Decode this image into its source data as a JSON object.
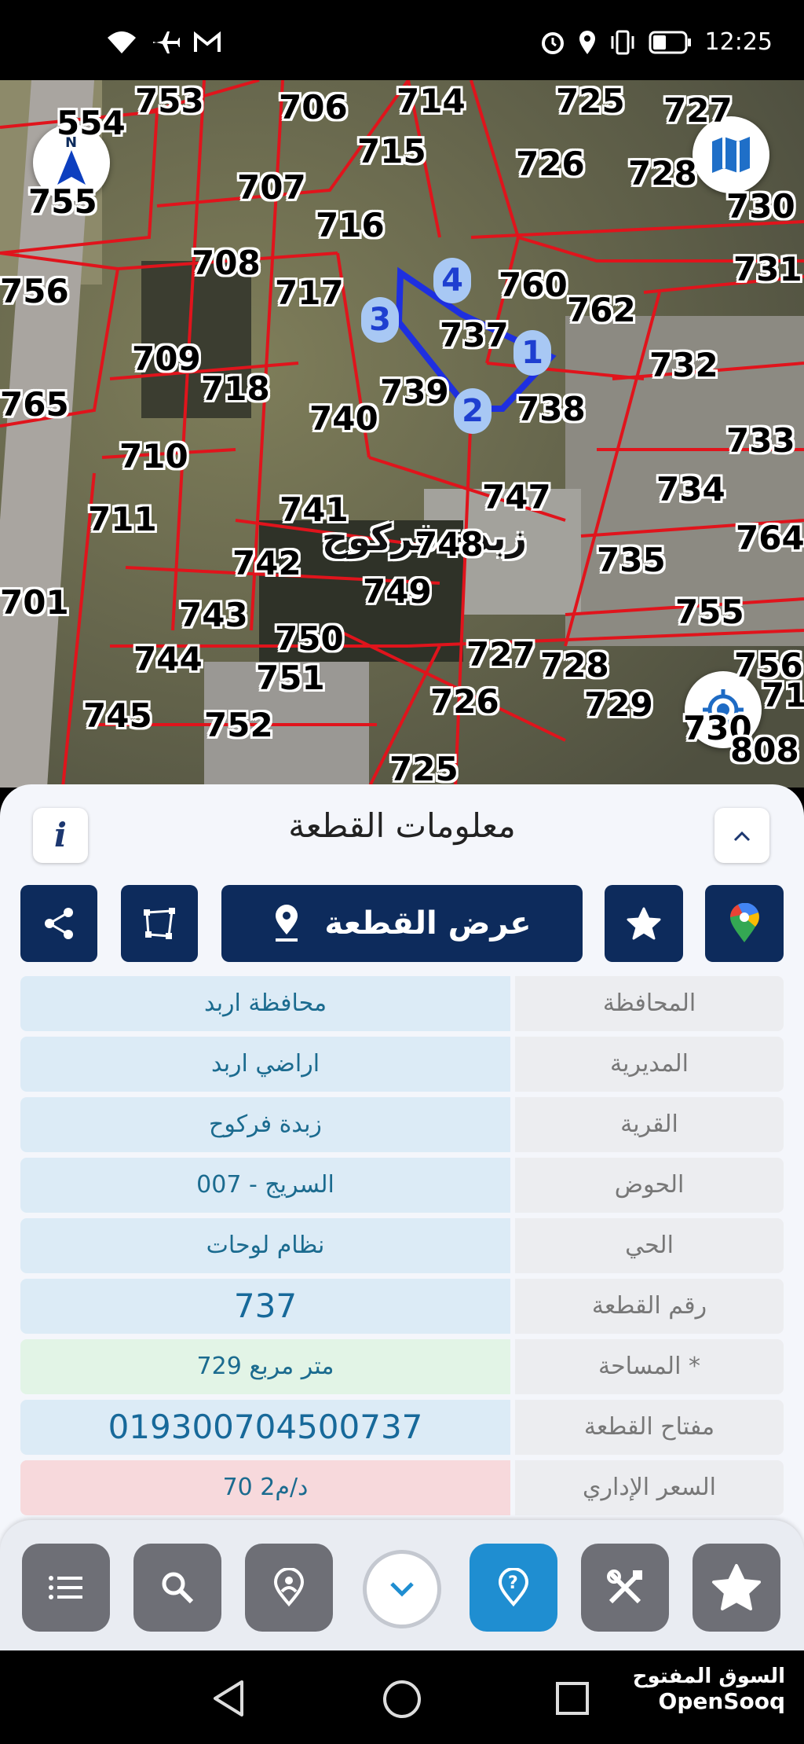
{
  "status_bar": {
    "time": "12:25",
    "icons": [
      "wifi-icon",
      "airplane-icon",
      "gmail-icon",
      "alarm-icon",
      "location-icon",
      "vibrate-icon",
      "battery-icon"
    ]
  },
  "map": {
    "parcel_labels": [
      {
        "text": "753"
      },
      {
        "text": "706"
      },
      {
        "text": "714"
      },
      {
        "text": "725"
      },
      {
        "text": "727"
      },
      {
        "text": "554"
      },
      {
        "text": "715"
      },
      {
        "text": "726"
      },
      {
        "text": "728"
      },
      {
        "text": "755"
      },
      {
        "text": "707"
      },
      {
        "text": "730"
      },
      {
        "text": "716"
      },
      {
        "text": "731"
      },
      {
        "text": "756"
      },
      {
        "text": "708"
      },
      {
        "text": "717"
      },
      {
        "text": "760"
      },
      {
        "text": "762"
      },
      {
        "text": "737"
      },
      {
        "text": "709"
      },
      {
        "text": "732"
      },
      {
        "text": "765"
      },
      {
        "text": "718"
      },
      {
        "text": "739"
      },
      {
        "text": "738"
      },
      {
        "text": "740"
      },
      {
        "text": "733"
      },
      {
        "text": "710"
      },
      {
        "text": "747"
      },
      {
        "text": "734"
      },
      {
        "text": "711"
      },
      {
        "text": "741"
      },
      {
        "text": "748"
      },
      {
        "text": "764"
      },
      {
        "text": "742"
      },
      {
        "text": "735"
      },
      {
        "text": "701"
      },
      {
        "text": "749"
      },
      {
        "text": "743"
      },
      {
        "text": "755"
      },
      {
        "text": "750"
      },
      {
        "text": "756"
      },
      {
        "text": "744"
      },
      {
        "text": "727"
      },
      {
        "text": "728"
      },
      {
        "text": "751"
      },
      {
        "text": "71"
      },
      {
        "text": "745"
      },
      {
        "text": "726"
      },
      {
        "text": "729"
      },
      {
        "text": "752"
      },
      {
        "text": "730"
      },
      {
        "text": "808"
      },
      {
        "text": "725"
      }
    ],
    "village_name": "زبدة فركوح",
    "vertices": [
      "1",
      "2",
      "3",
      "4"
    ],
    "compass_letter": "N"
  },
  "panel": {
    "title": "معلومات القطعة",
    "info_label": "i",
    "show_parcel_button": "عرض القطعة",
    "rows": [
      {
        "label": "المحافظة",
        "value": "محافظة اربد"
      },
      {
        "label": "المديرية",
        "value": "اراضي اربد"
      },
      {
        "label": "القرية",
        "value": "زبدة فركوح"
      },
      {
        "label": "الحوض",
        "value": "السريج - 007"
      },
      {
        "label": "الحي",
        "value": "نظام لوحات"
      },
      {
        "label": "رقم القطعة",
        "value": "737"
      },
      {
        "label": "المساحة *",
        "value": "729   متر مربع"
      },
      {
        "label": "مفتاح القطعة",
        "value": "019300704500737"
      },
      {
        "label": "السعر الإداري",
        "value": "70 د/م2"
      }
    ]
  },
  "toolbar": {
    "items": [
      "list-icon",
      "search-icon",
      "location-pin-icon",
      "chevron-down-icon",
      "help-icon",
      "tools-icon",
      "star-icon"
    ]
  },
  "watermark": {
    "arabic": "السوق المفتوح",
    "latin": "OpenSooq"
  },
  "colors": {
    "navy": "#0d2b5c",
    "parcel_line": "#e0141c",
    "selected_parcel": "#1e2fe0",
    "value_bg": "#dcebf6",
    "area_bg": "#e2f4e6",
    "price_bg": "#f7d9dc",
    "active_tool": "#1f8ed1"
  }
}
